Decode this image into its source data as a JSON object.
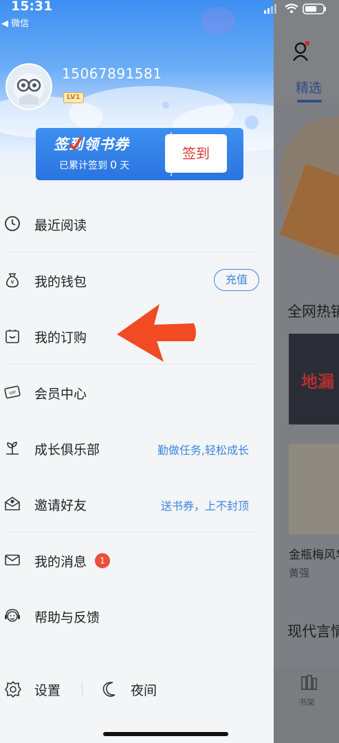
{
  "status_bar": {
    "time": "15:31",
    "back_app": "◀ 微信"
  },
  "profile": {
    "phone": "15067891581",
    "level": "LV1"
  },
  "checkin_card": {
    "title": "签到领书券",
    "sub_prefix": "已累计签到",
    "days": "0",
    "sub_suffix": "天",
    "button": "签到"
  },
  "menu": {
    "recent": "最近阅读",
    "wallet": "我的钱包",
    "recharge": "充值",
    "subscriptions": "我的订购",
    "vip": "会员中心",
    "club": "成长俱乐部",
    "club_hint": "勤做任务,轻松成长",
    "invite": "邀请好友",
    "invite_hint": "送书券，上不封顶",
    "messages": "我的消息",
    "messages_badge": "1",
    "help": "帮助与反馈"
  },
  "bottom": {
    "settings": "设置",
    "night": "夜间"
  },
  "background_app": {
    "tab": "精选",
    "section1": "全网热销",
    "book_cover_text": "地漏",
    "book_title": "金瓶梅风华",
    "book_author": "黄强",
    "section2": "现代言情",
    "bottom_tab": "书架"
  },
  "colors": {
    "accent": "#3b86e0",
    "signin_red": "#d83b2e",
    "arrow": "#f24a23",
    "badge": "#eb4f38"
  }
}
